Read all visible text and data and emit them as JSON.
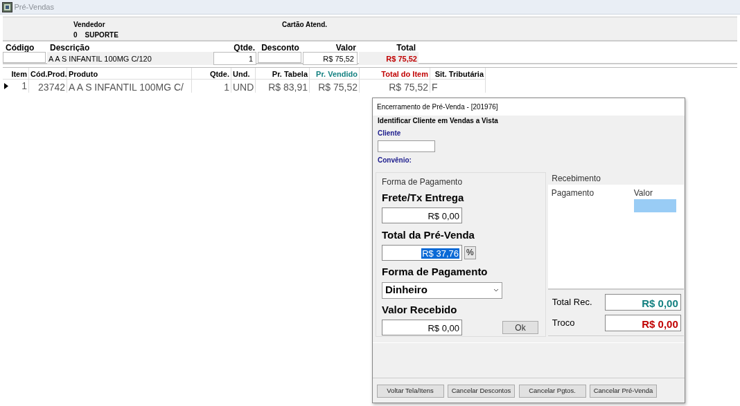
{
  "window": {
    "title": "Pré-Vendas"
  },
  "header": {
    "vendedor_label": "Vendedor",
    "vendedor_code": "0",
    "vendedor_name": "SUPORTE",
    "cartao_label": "Cartão Atend."
  },
  "entry": [
    {
      "label": "Código",
      "kind": "input"
    },
    {
      "label": "Descrição",
      "value": "A A S INFANTIL 100MG C/120",
      "kind": "text"
    },
    {
      "label": "Qtde.",
      "value": "1",
      "kind": "input"
    },
    {
      "label": "Desconto",
      "kind": "input"
    },
    {
      "label": "Valor",
      "value": "R$ 75,52",
      "kind": "input"
    },
    {
      "label": "Total",
      "value": "R$ 75,52",
      "kind": "total"
    }
  ],
  "grid": {
    "columns": [
      {
        "label": "Item",
        "color": "#000000"
      },
      {
        "label": "Cód.Prod.",
        "color": "#000000"
      },
      {
        "label": "Produto",
        "color": "#000000"
      },
      {
        "label": "Qtde.",
        "color": "#000000"
      },
      {
        "label": "Und.",
        "color": "#000000"
      },
      {
        "label": "Pr. Tabela",
        "color": "#000000"
      },
      {
        "label": "Pr. Vendido",
        "color": "#138080"
      },
      {
        "label": "Total do Item",
        "color": "#c00000"
      },
      {
        "label": "Sit. Tributária",
        "color": "#000000"
      }
    ],
    "rows": [
      {
        "current": true,
        "cells": [
          "1",
          "23742",
          "A A S INFANTIL 100MG C/",
          "1",
          "UND",
          "R$ 83,91",
          "R$ 75,52",
          "R$ 75,52",
          "F"
        ]
      }
    ]
  },
  "dialog": {
    "title": "Encerramento de Pré-Venda  -  [201976]",
    "section_title": "Identificar Cliente em Vendas a Vista",
    "cliente_label": "Cliente",
    "convenio_label": "Convênio:",
    "payment": {
      "legend": "Forma de Pagamento",
      "frete_label": "Frete/Tx Entrega",
      "frete_value": "R$ 0,00",
      "total_label": "Total da Pré-Venda",
      "total_value": "R$ 37,76",
      "total_selected": true,
      "percent_button": "%",
      "forma_label": "Forma de Pagamento",
      "forma_value": "Dinheiro",
      "recebido_label": "Valor Recebido",
      "recebido_value": "R$ 0,00",
      "ok_button": "Ok"
    },
    "receipt": {
      "legend": "Recebimento",
      "columns": [
        "Pagamento",
        "Valor"
      ],
      "total_rec_label": "Total Rec.",
      "total_rec_value": "R$ 0,00",
      "troco_label": "Troco",
      "troco_value": "R$ 0,00"
    },
    "buttons": [
      "Voltar Tela/Itens",
      "Cancelar Descontos",
      "Cancelar Pgtos.",
      "Cancelar Pré-Venda"
    ]
  }
}
